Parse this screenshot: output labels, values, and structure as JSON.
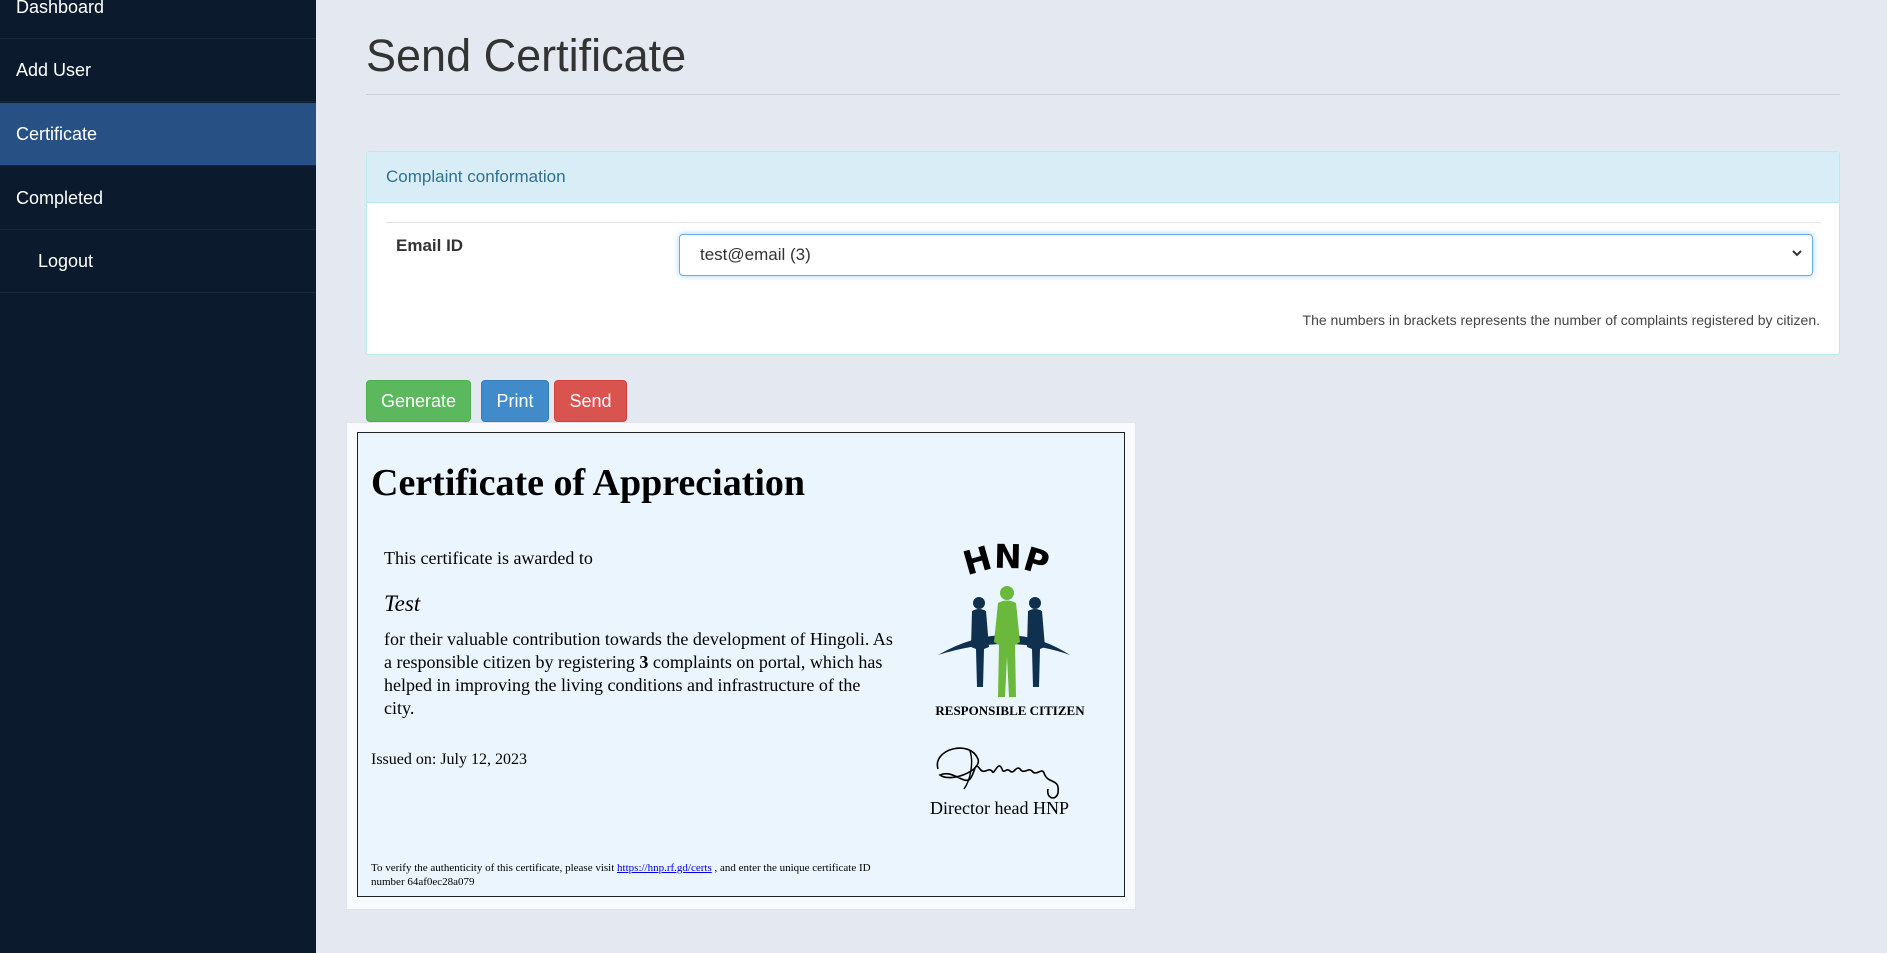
{
  "sidebar": {
    "items": [
      {
        "label": "Dashboard"
      },
      {
        "label": "Add User"
      },
      {
        "label": "Certificate"
      },
      {
        "label": "Completed"
      },
      {
        "label": "Logout"
      }
    ]
  },
  "page": {
    "title": "Send Certificate"
  },
  "panel": {
    "heading": "Complaint conformation",
    "email_label": "Email ID",
    "email_selected": "test@email (3)",
    "help_text": "The numbers in brackets represents the number of complaints registered by citizen."
  },
  "actions": {
    "generate": "Generate",
    "print": "Print",
    "send": "Send"
  },
  "certificate": {
    "title": "Certificate of Appreciation",
    "awarded_to": "This certificate is awarded to",
    "recipient": "Test",
    "body_before": "for their valuable contribution towards the development of Hingoli. As a responsible citizen by registering ",
    "complaint_count": "3",
    "body_after": " complaints on portal, which has helped in improving the living conditions and infrastructure of the city.",
    "issued": "Issued on: July 12, 2023",
    "logo_text": "HNP",
    "logo_caption": "RESPONSIBLE CITIZEN",
    "signatory": "Director head HNP",
    "verify_prefix": "To verify the authenticity of this certificate, please visit ",
    "verify_link": "https://hnp.rf.gd/certs",
    "verify_suffix": " , and enter the unique certificate ID number 64af0ec28a079"
  },
  "colors": {
    "sidebar_bg": "#0b1a2c",
    "sidebar_active": "#275185",
    "page_bg": "#e4e9f1",
    "panel_heading_bg": "#d9edf7",
    "generate": "#5cb85c",
    "print": "#428bca",
    "send": "#d9534f",
    "certificate_bg": "#eaf5fd",
    "logo_navy": "#10304f",
    "logo_green": "#6ab93d"
  },
  "icons": {
    "select_arrow": "chevron-down-icon",
    "logo": "hnp-logo",
    "signature": "signature-image"
  }
}
